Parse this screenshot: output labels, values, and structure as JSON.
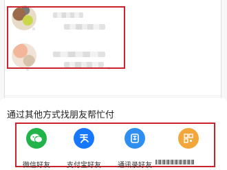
{
  "sheet": {
    "title": "通过其他方式找朋友帮忙付",
    "options": [
      {
        "label": "微信好友",
        "icon": "wechat-icon",
        "color": "#22b34a"
      },
      {
        "label": "支付宝好友",
        "icon": "alipay-icon",
        "color": "#1677ff"
      },
      {
        "label": "通讯录好友",
        "icon": "contacts-icon",
        "color": "#2e8ff0"
      },
      {
        "label": "",
        "icon": "qrcode-icon",
        "color": "#f3a63a"
      }
    ]
  },
  "colors": {
    "highlight": "#c9222a",
    "background": "#f7f7f7"
  }
}
